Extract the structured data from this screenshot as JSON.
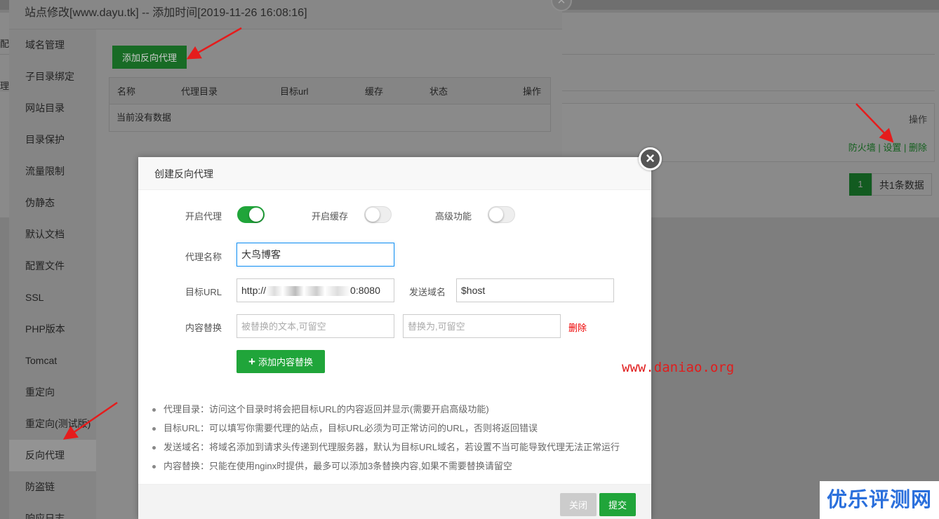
{
  "background": {
    "left_fragment_1": "配",
    "left_fragment_2": "理",
    "table_header_ops": "操作",
    "row_actions": [
      "防火墙",
      "设置",
      "删除"
    ],
    "pager_current": "1",
    "pager_total": "共1条数据"
  },
  "site_window": {
    "title": "站点修改[www.dayu.tk] -- 添加时间[2019-11-26 16:08:16]",
    "close_glyph": "×",
    "sidebar": [
      {
        "label": "域名管理"
      },
      {
        "label": "子目录绑定"
      },
      {
        "label": "网站目录"
      },
      {
        "label": "目录保护"
      },
      {
        "label": "流量限制"
      },
      {
        "label": "伪静态"
      },
      {
        "label": "默认文档"
      },
      {
        "label": "配置文件"
      },
      {
        "label": "SSL"
      },
      {
        "label": "PHP版本"
      },
      {
        "label": "Tomcat"
      },
      {
        "label": "重定向"
      },
      {
        "label": "重定向(测试版)"
      },
      {
        "label": "反向代理"
      },
      {
        "label": "防盗链"
      },
      {
        "label": "响应日志"
      }
    ],
    "active_item": "反向代理",
    "add_button": "添加反向代理",
    "table": {
      "columns": [
        "名称",
        "代理目录",
        "目标url",
        "缓存",
        "状态",
        "操作"
      ],
      "empty_text": "当前没有数据"
    }
  },
  "dialog": {
    "title": "创建反向代理",
    "close_glyph": "×",
    "toggles": [
      {
        "label": "开启代理",
        "on": true
      },
      {
        "label": "开启缓存",
        "on": false
      },
      {
        "label": "高级功能",
        "on": false
      }
    ],
    "proxy_name_label": "代理名称",
    "proxy_name_value": "大鸟博客",
    "target_url_label": "目标URL",
    "target_url_prefix": "http://",
    "target_url_suffix": "0:8080",
    "send_domain_label": "发送域名",
    "send_domain_value": "$host",
    "content_replace_label": "内容替换",
    "replace_from_placeholder": "被替换的文本,可留空",
    "replace_to_placeholder": "替换为,可留空",
    "delete_link": "删除",
    "add_replace_button": "添加内容替换",
    "help": [
      "代理目录：访问这个目录时将会把目标URL的内容返回并显示(需要开启高级功能)",
      "目标URL：可以填写你需要代理的站点，目标URL必须为可正常访问的URL，否则将返回错误",
      "发送域名：将域名添加到请求头传递到代理服务器，默认为目标URL域名，若设置不当可能导致代理无法正常运行",
      "内容替换：只能在使用nginx时提供，最多可以添加3条替换内容,如果不需要替换请留空"
    ],
    "close_button": "关闭",
    "submit_button": "提交"
  },
  "watermark": {
    "url": "www.daniao.org",
    "logo": "优乐评测网"
  },
  "colors": {
    "accent": "#20a53a",
    "danger": "#e00000",
    "arrow": "#e51c1c"
  }
}
